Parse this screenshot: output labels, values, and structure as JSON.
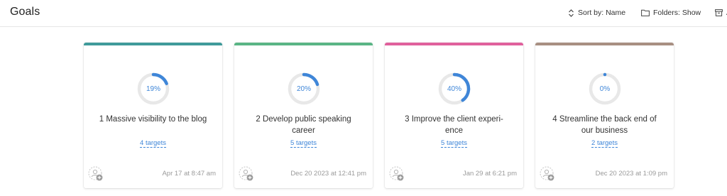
{
  "header": {
    "title": "Goals",
    "sort": {
      "label": "Sort by: Name",
      "icon": "sort-icon"
    },
    "folders": {
      "label": "Folders: Show",
      "icon": "folder-icon"
    },
    "archive": {
      "label": "A",
      "icon": "archive-icon"
    }
  },
  "colors": {
    "ring_track": "#e8e8e8",
    "ring_progress": "#3f86d8",
    "link": "#3f86d8"
  },
  "goals": [
    {
      "title": "1 Massive visibility to the blog",
      "progress": 19,
      "progress_label": "19%",
      "targets": "4 targets",
      "timestamp": "Apr 17 at 8:47 am",
      "color": "#3f9a9a"
    },
    {
      "title": "2 Develop public speaking career",
      "progress": 20,
      "progress_label": "20%",
      "targets": "5 targets",
      "timestamp": "Dec 20 2023 at 12:41 pm",
      "color": "#5ab585"
    },
    {
      "title": "3 Improve the client experi-ence",
      "progress": 40,
      "progress_label": "40%",
      "targets": "5 targets",
      "timestamp": "Jan 29 at 6:21 pm",
      "color": "#e0609c"
    },
    {
      "title": "4 Streamline the back end of our business",
      "progress": 0,
      "progress_label": "0%",
      "targets": "2 targets",
      "timestamp": "Dec 20 2023 at 1:09 pm",
      "color": "#a88f82"
    }
  ]
}
